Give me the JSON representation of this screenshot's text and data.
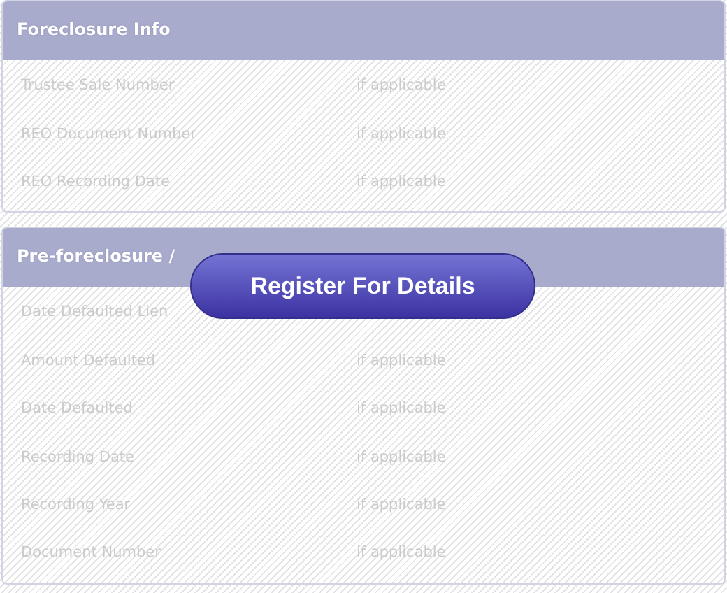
{
  "sections": [
    {
      "title": "Foreclosure Info",
      "rows": [
        {
          "label": "Trustee Sale Number",
          "value": "if applicable"
        },
        {
          "label": "REO Document Number",
          "value": "if applicable"
        },
        {
          "label": "REO Recording Date",
          "value": "if applicable"
        }
      ]
    },
    {
      "title": "Pre-foreclosure /",
      "rows": [
        {
          "label": "Date Defaulted Lien"
        },
        {
          "label": "Amount Defaulted",
          "value": "if applicable"
        },
        {
          "label": "Date Defaulted",
          "value": "if applicable"
        },
        {
          "label": "Recording Date",
          "value": "if applicable"
        },
        {
          "label": "Recording Year",
          "value": "if applicable"
        },
        {
          "label": "Document Number",
          "value": "if applicable"
        }
      ]
    }
  ],
  "register_button": {
    "label": "Register For Details"
  }
}
